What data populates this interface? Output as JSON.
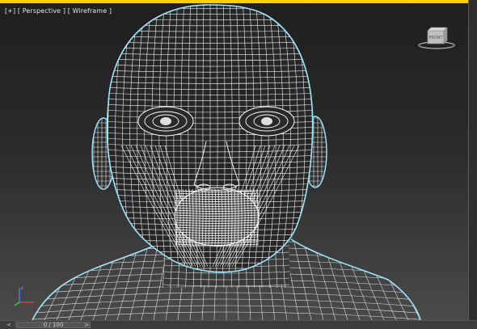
{
  "viewport": {
    "label_plus": "[+]",
    "label_view": "[ Perspective ]",
    "label_shading": "[ Wireframe ]",
    "viewcube_face": "FRONT",
    "frame_color": "#ffd000",
    "wire_color": "#ffffff",
    "silhouette_color": "#9fe6ff"
  },
  "timeline": {
    "prev": "<",
    "counter": "0 / 100",
    "next": ">"
  },
  "icons": [
    "viewcube-icon",
    "axis-tripod-icon"
  ]
}
